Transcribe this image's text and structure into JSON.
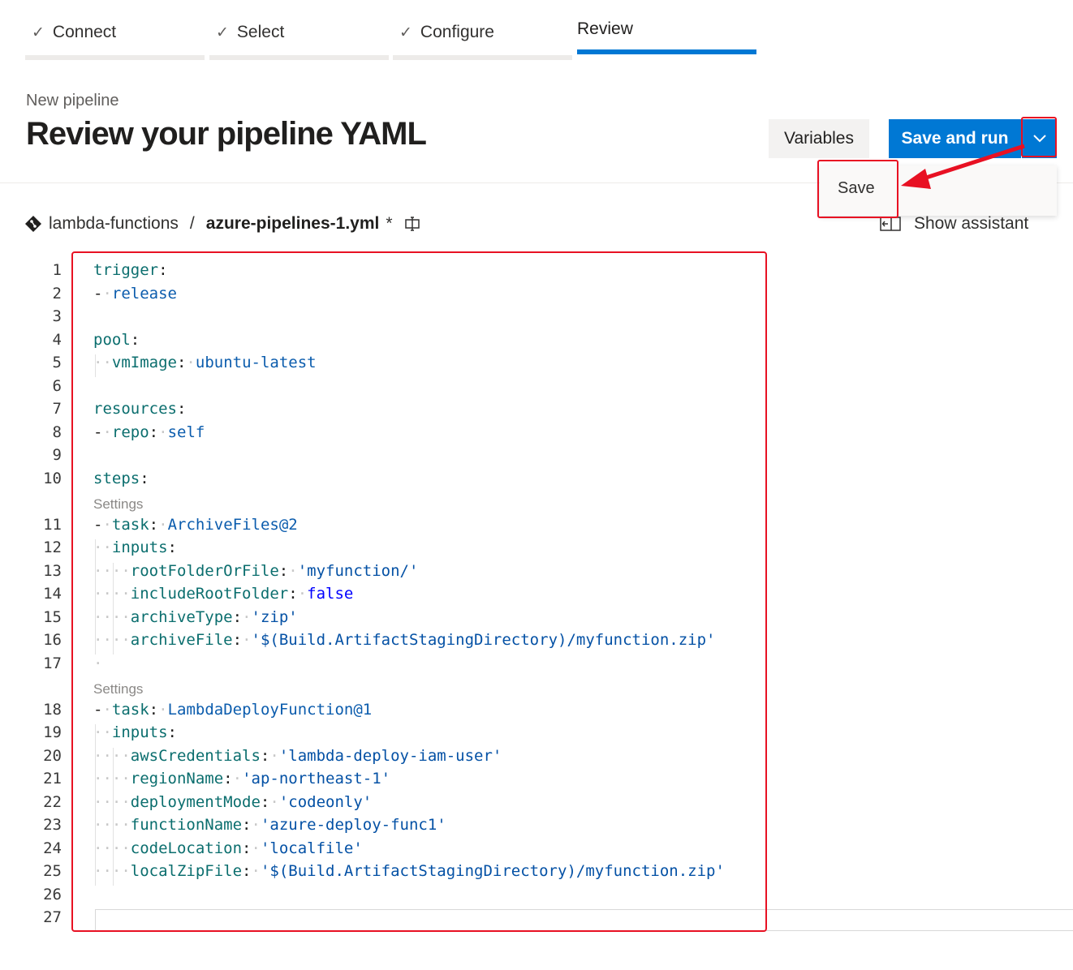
{
  "wizard": {
    "steps": [
      {
        "label": "Connect",
        "done": true
      },
      {
        "label": "Select",
        "done": true
      },
      {
        "label": "Configure",
        "done": true
      },
      {
        "label": "Review",
        "done": false,
        "active": true
      }
    ]
  },
  "header": {
    "subtitle": "New pipeline",
    "title": "Review your pipeline YAML",
    "variables_label": "Variables",
    "save_run_label": "Save and run"
  },
  "dropdown": {
    "items": [
      "Save"
    ]
  },
  "path": {
    "repo": "lambda-functions",
    "separator": "/",
    "file": "azure-pipelines-1.yml",
    "modified_marker": "*"
  },
  "assistant": {
    "label": "Show assistant"
  },
  "editor": {
    "codelens_label": "Settings",
    "lines": [
      {
        "n": "1",
        "text": "trigger:"
      },
      {
        "n": "2",
        "text": "- release"
      },
      {
        "n": "3",
        "text": ""
      },
      {
        "n": "4",
        "text": "pool:"
      },
      {
        "n": "5",
        "text": "  vmImage: ubuntu-latest"
      },
      {
        "n": "6",
        "text": ""
      },
      {
        "n": "7",
        "text": "resources:"
      },
      {
        "n": "8",
        "text": "- repo: self"
      },
      {
        "n": "9",
        "text": ""
      },
      {
        "n": "10",
        "text": "steps:"
      },
      {
        "n": "11",
        "text": "- task: ArchiveFiles@2"
      },
      {
        "n": "12",
        "text": "  inputs:"
      },
      {
        "n": "13",
        "text": "    rootFolderOrFile: 'myfunction/'"
      },
      {
        "n": "14",
        "text": "    includeRootFolder: false"
      },
      {
        "n": "15",
        "text": "    archiveType: 'zip'"
      },
      {
        "n": "16",
        "text": "    archiveFile: '$(Build.ArtifactStagingDirectory)/myfunction.zip'"
      },
      {
        "n": "17",
        "text": " "
      },
      {
        "n": "18",
        "text": "- task: LambdaDeployFunction@1"
      },
      {
        "n": "19",
        "text": "  inputs:"
      },
      {
        "n": "20",
        "text": "    awsCredentials: 'lambda-deploy-iam-user'"
      },
      {
        "n": "21",
        "text": "    regionName: 'ap-northeast-1'"
      },
      {
        "n": "22",
        "text": "    deploymentMode: 'codeonly'"
      },
      {
        "n": "23",
        "text": "    functionName: 'azure-deploy-func1'"
      },
      {
        "n": "24",
        "text": "    codeLocation: 'localfile'"
      },
      {
        "n": "25",
        "text": "    localZipFile: '$(Build.ArtifactStagingDirectory)/myfunction.zip'"
      },
      {
        "n": "26",
        "text": ""
      },
      {
        "n": "27",
        "text": ""
      }
    ]
  },
  "colors": {
    "accent": "#0078d4",
    "highlight": "#e81123"
  },
  "icons": {
    "step_done": "check-icon",
    "repo": "git-diamond-icon",
    "rename": "rename-icon",
    "assistant": "assistant-panel-icon",
    "dropdown": "chevron-down-icon"
  }
}
